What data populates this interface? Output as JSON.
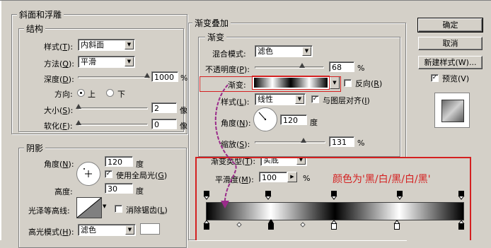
{
  "bevel": {
    "group_title": "斜面和浮雕",
    "structure_title": "结构",
    "style_label": "样式(",
    "style_key": "T",
    "style_close": "):",
    "style_value": "内斜面",
    "method_label": "方法(",
    "method_key": "Q",
    "method_close": "):",
    "method_value": "平滑",
    "depth_label": "深度(",
    "depth_key": "D",
    "depth_close": "):",
    "depth_value": "1000",
    "depth_unit": "%",
    "depth_slider": 1.0,
    "direction_label": "方向:",
    "direction_up": "上",
    "direction_down": "下",
    "size_label": "大小(",
    "size_key": "S",
    "size_close": "):",
    "size_value": "2",
    "size_unit": "像",
    "size_slider": 0.0,
    "soften_label": "软化(",
    "soften_key": "F",
    "soften_close": "):",
    "soften_value": "0",
    "soften_unit": "像",
    "soften_slider": 0.0
  },
  "shading": {
    "title": "阴影",
    "angle_label": "角度(",
    "angle_key": "N",
    "angle_close": "):",
    "angle_value": "120",
    "angle_unit": "度",
    "global_light_label": "使用全局光(",
    "global_light_key": "G",
    "global_light_close": ")",
    "global_light_checked": true,
    "altitude_label": "高度:",
    "altitude_value": "30",
    "altitude_unit": "度",
    "gloss_label": "光泽等高线:",
    "antialias_label": "消除锯齿(",
    "antialias_key": "L",
    "antialias_close": ")",
    "highlight_label": "高光模式(",
    "highlight_key": "H",
    "highlight_close": "):",
    "highlight_value": "滤色"
  },
  "gradient_overlay": {
    "group_title": "渐变叠加",
    "sub_title": "渐变",
    "blend_label": "混合模式:",
    "blend_value": "滤色",
    "opacity_label": "不透明度(",
    "opacity_key": "P",
    "opacity_close": "):",
    "opacity_value": "68",
    "opacity_unit": "%",
    "opacity_slider": 0.68,
    "gradient_label": "渐变:",
    "reverse_label": "反向(",
    "reverse_key": "R",
    "reverse_close": ")",
    "style_label": "样式(",
    "style_key": "L",
    "style_close": "):",
    "style_value": "线性",
    "align_label": "与图层对齐(",
    "align_key": "I",
    "align_close": ")",
    "align_checked": true,
    "angle_label": "角度(",
    "angle_key": "N",
    "angle_close": "):",
    "angle_value": "120",
    "angle_unit": "度",
    "scale_label": "缩放(",
    "scale_key": "S",
    "scale_close": "):",
    "scale_value": "131",
    "scale_unit": "%",
    "scale_slider": 0.65
  },
  "gradient_editor": {
    "type_label": "渐变类型(",
    "type_key": "T",
    "type_close": "):",
    "type_value": "实底",
    "smooth_label": "平滑度(",
    "smooth_key": "M",
    "smooth_close": "):",
    "smooth_value": "100",
    "smooth_unit": "%",
    "annotation": "颜色为'黑/白/黑/白/黑'"
  },
  "buttons": {
    "ok": "确定",
    "cancel": "取消",
    "new_style": "新建样式(W)...",
    "preview": "预览(V)",
    "preview_checked": true
  },
  "colors": {
    "dialog_bg": "#d4d0c8",
    "annotation_red": "#d42020",
    "arrow_purple": "#9a2b8a"
  }
}
